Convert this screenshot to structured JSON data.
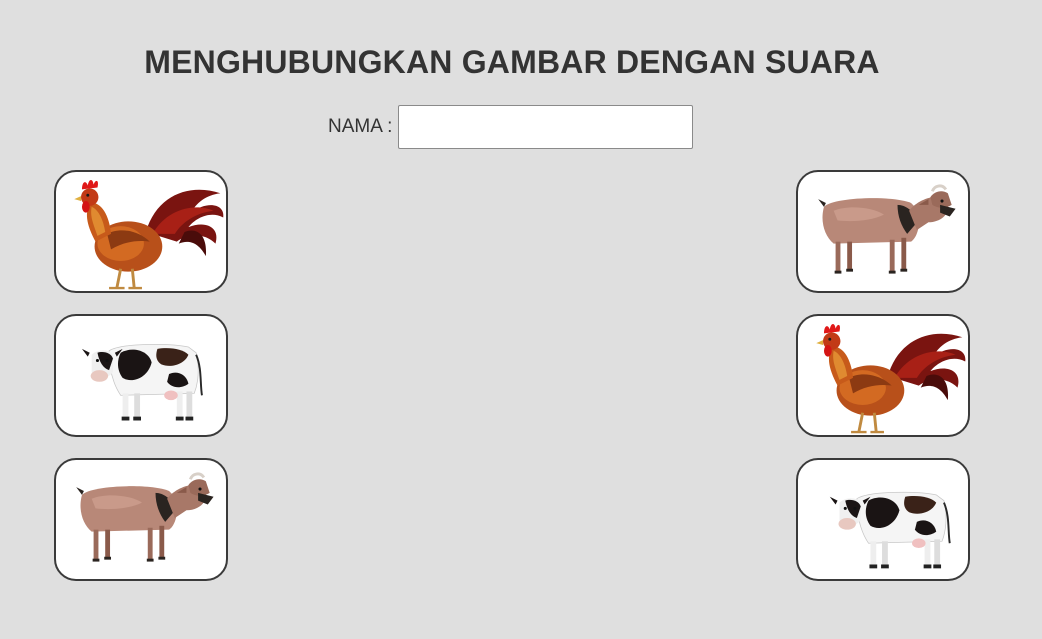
{
  "title": "MENGHUBUNGKAN GAMBAR DENGAN SUARA",
  "name_field": {
    "label": "NAMA :",
    "value": "",
    "placeholder": ""
  },
  "left_cards": [
    {
      "animal": "rooster"
    },
    {
      "animal": "cow"
    },
    {
      "animal": "goat"
    }
  ],
  "right_cards": [
    {
      "animal": "goat"
    },
    {
      "animal": "rooster"
    },
    {
      "animal": "cow"
    }
  ],
  "colors": {
    "background": "#dfdfdf",
    "text": "#333333",
    "card_border": "#3a3a3a"
  }
}
